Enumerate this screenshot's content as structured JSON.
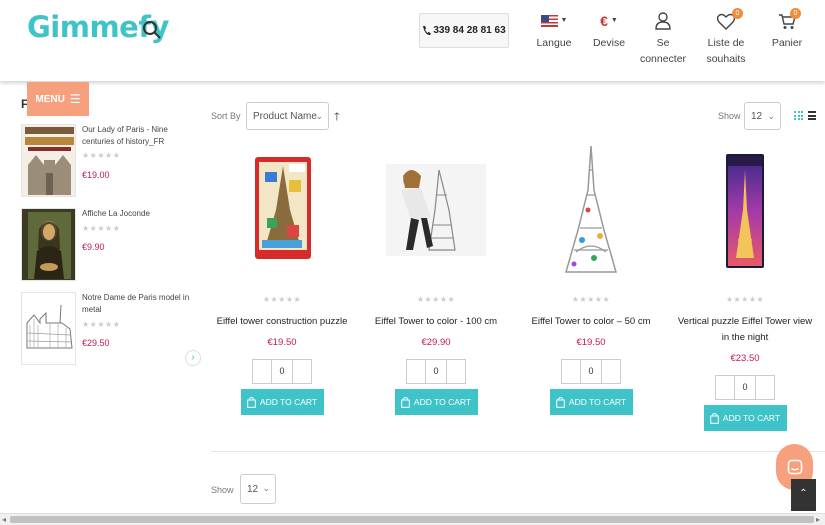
{
  "header": {
    "logo": "Gimmefy",
    "phone": "339 84 28 81 63",
    "language_label": "Langue",
    "currency_symbol": "€",
    "currency_label": "Devise",
    "login_label_1": "Se",
    "login_label_2": "connecter",
    "wishlist_label_1": "Liste de",
    "wishlist_label_2": "souhaits",
    "wishlist_count": "0",
    "cart_label": "Panier",
    "cart_count": "0"
  },
  "menu": {
    "label": "MENU",
    "sidebar_letter": "F"
  },
  "sidebar": {
    "products": [
      {
        "title": "Our Lady of Paris - Nine centuries of history_FR",
        "price": "€19.00"
      },
      {
        "title": "Affiche La Joconde",
        "price": "€9.90"
      },
      {
        "title": "Notre Dame de Paris model in metal",
        "price": "€29.50"
      }
    ],
    "stars": "★★★★★",
    "next_arrow": "›"
  },
  "toolbar": {
    "sort_label": "Sort By",
    "sort_value": "Product Name",
    "show_label": "Show",
    "show_value": "12"
  },
  "products": [
    {
      "title": "Eiffel tower construction puzzle",
      "price": "€19.50",
      "qty": "0",
      "button": "ADD TO CART"
    },
    {
      "title": "Eiffel Tower to color - 100 cm",
      "price": "€29.90",
      "qty": "0",
      "button": "ADD TO CART"
    },
    {
      "title": "Eiffel Tower to color – 50 cm",
      "price": "€19.50",
      "qty": "0",
      "button": "ADD TO CART"
    },
    {
      "title": "Vertical puzzle Eiffel Tower view in the night",
      "price": "€23.50",
      "qty": "0",
      "button": "ADD TO CART"
    }
  ],
  "bottom": {
    "show_label": "Show",
    "show_value": "12"
  },
  "colors": {
    "accent": "#3ec3c8",
    "menu": "#f7a07e",
    "price": "#c2185b",
    "badge": "#f28b3c"
  }
}
